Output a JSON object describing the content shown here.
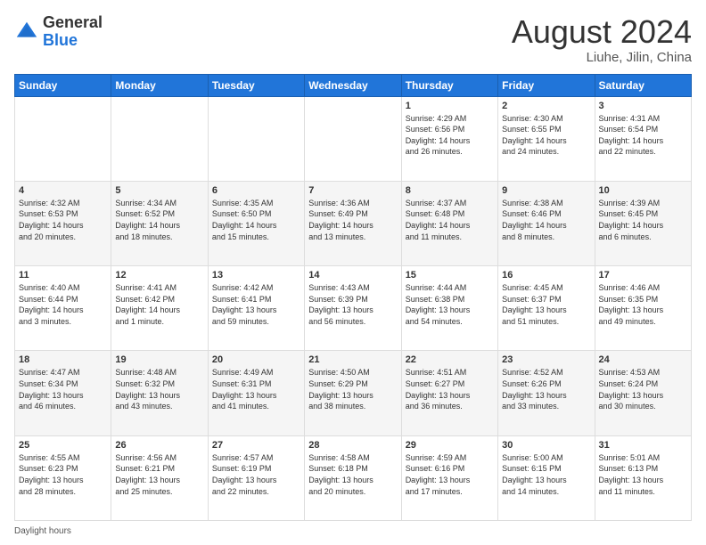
{
  "logo": {
    "general": "General",
    "blue": "Blue"
  },
  "title": "August 2024",
  "location": "Liuhe, Jilin, China",
  "days_of_week": [
    "Sunday",
    "Monday",
    "Tuesday",
    "Wednesday",
    "Thursday",
    "Friday",
    "Saturday"
  ],
  "footer": "Daylight hours",
  "weeks": [
    [
      {
        "day": "",
        "info": ""
      },
      {
        "day": "",
        "info": ""
      },
      {
        "day": "",
        "info": ""
      },
      {
        "day": "",
        "info": ""
      },
      {
        "day": "1",
        "info": "Sunrise: 4:29 AM\nSunset: 6:56 PM\nDaylight: 14 hours\nand 26 minutes."
      },
      {
        "day": "2",
        "info": "Sunrise: 4:30 AM\nSunset: 6:55 PM\nDaylight: 14 hours\nand 24 minutes."
      },
      {
        "day": "3",
        "info": "Sunrise: 4:31 AM\nSunset: 6:54 PM\nDaylight: 14 hours\nand 22 minutes."
      }
    ],
    [
      {
        "day": "4",
        "info": "Sunrise: 4:32 AM\nSunset: 6:53 PM\nDaylight: 14 hours\nand 20 minutes."
      },
      {
        "day": "5",
        "info": "Sunrise: 4:34 AM\nSunset: 6:52 PM\nDaylight: 14 hours\nand 18 minutes."
      },
      {
        "day": "6",
        "info": "Sunrise: 4:35 AM\nSunset: 6:50 PM\nDaylight: 14 hours\nand 15 minutes."
      },
      {
        "day": "7",
        "info": "Sunrise: 4:36 AM\nSunset: 6:49 PM\nDaylight: 14 hours\nand 13 minutes."
      },
      {
        "day": "8",
        "info": "Sunrise: 4:37 AM\nSunset: 6:48 PM\nDaylight: 14 hours\nand 11 minutes."
      },
      {
        "day": "9",
        "info": "Sunrise: 4:38 AM\nSunset: 6:46 PM\nDaylight: 14 hours\nand 8 minutes."
      },
      {
        "day": "10",
        "info": "Sunrise: 4:39 AM\nSunset: 6:45 PM\nDaylight: 14 hours\nand 6 minutes."
      }
    ],
    [
      {
        "day": "11",
        "info": "Sunrise: 4:40 AM\nSunset: 6:44 PM\nDaylight: 14 hours\nand 3 minutes."
      },
      {
        "day": "12",
        "info": "Sunrise: 4:41 AM\nSunset: 6:42 PM\nDaylight: 14 hours\nand 1 minute."
      },
      {
        "day": "13",
        "info": "Sunrise: 4:42 AM\nSunset: 6:41 PM\nDaylight: 13 hours\nand 59 minutes."
      },
      {
        "day": "14",
        "info": "Sunrise: 4:43 AM\nSunset: 6:39 PM\nDaylight: 13 hours\nand 56 minutes."
      },
      {
        "day": "15",
        "info": "Sunrise: 4:44 AM\nSunset: 6:38 PM\nDaylight: 13 hours\nand 54 minutes."
      },
      {
        "day": "16",
        "info": "Sunrise: 4:45 AM\nSunset: 6:37 PM\nDaylight: 13 hours\nand 51 minutes."
      },
      {
        "day": "17",
        "info": "Sunrise: 4:46 AM\nSunset: 6:35 PM\nDaylight: 13 hours\nand 49 minutes."
      }
    ],
    [
      {
        "day": "18",
        "info": "Sunrise: 4:47 AM\nSunset: 6:34 PM\nDaylight: 13 hours\nand 46 minutes."
      },
      {
        "day": "19",
        "info": "Sunrise: 4:48 AM\nSunset: 6:32 PM\nDaylight: 13 hours\nand 43 minutes."
      },
      {
        "day": "20",
        "info": "Sunrise: 4:49 AM\nSunset: 6:31 PM\nDaylight: 13 hours\nand 41 minutes."
      },
      {
        "day": "21",
        "info": "Sunrise: 4:50 AM\nSunset: 6:29 PM\nDaylight: 13 hours\nand 38 minutes."
      },
      {
        "day": "22",
        "info": "Sunrise: 4:51 AM\nSunset: 6:27 PM\nDaylight: 13 hours\nand 36 minutes."
      },
      {
        "day": "23",
        "info": "Sunrise: 4:52 AM\nSunset: 6:26 PM\nDaylight: 13 hours\nand 33 minutes."
      },
      {
        "day": "24",
        "info": "Sunrise: 4:53 AM\nSunset: 6:24 PM\nDaylight: 13 hours\nand 30 minutes."
      }
    ],
    [
      {
        "day": "25",
        "info": "Sunrise: 4:55 AM\nSunset: 6:23 PM\nDaylight: 13 hours\nand 28 minutes."
      },
      {
        "day": "26",
        "info": "Sunrise: 4:56 AM\nSunset: 6:21 PM\nDaylight: 13 hours\nand 25 minutes."
      },
      {
        "day": "27",
        "info": "Sunrise: 4:57 AM\nSunset: 6:19 PM\nDaylight: 13 hours\nand 22 minutes."
      },
      {
        "day": "28",
        "info": "Sunrise: 4:58 AM\nSunset: 6:18 PM\nDaylight: 13 hours\nand 20 minutes."
      },
      {
        "day": "29",
        "info": "Sunrise: 4:59 AM\nSunset: 6:16 PM\nDaylight: 13 hours\nand 17 minutes."
      },
      {
        "day": "30",
        "info": "Sunrise: 5:00 AM\nSunset: 6:15 PM\nDaylight: 13 hours\nand 14 minutes."
      },
      {
        "day": "31",
        "info": "Sunrise: 5:01 AM\nSunset: 6:13 PM\nDaylight: 13 hours\nand 11 minutes."
      }
    ]
  ]
}
